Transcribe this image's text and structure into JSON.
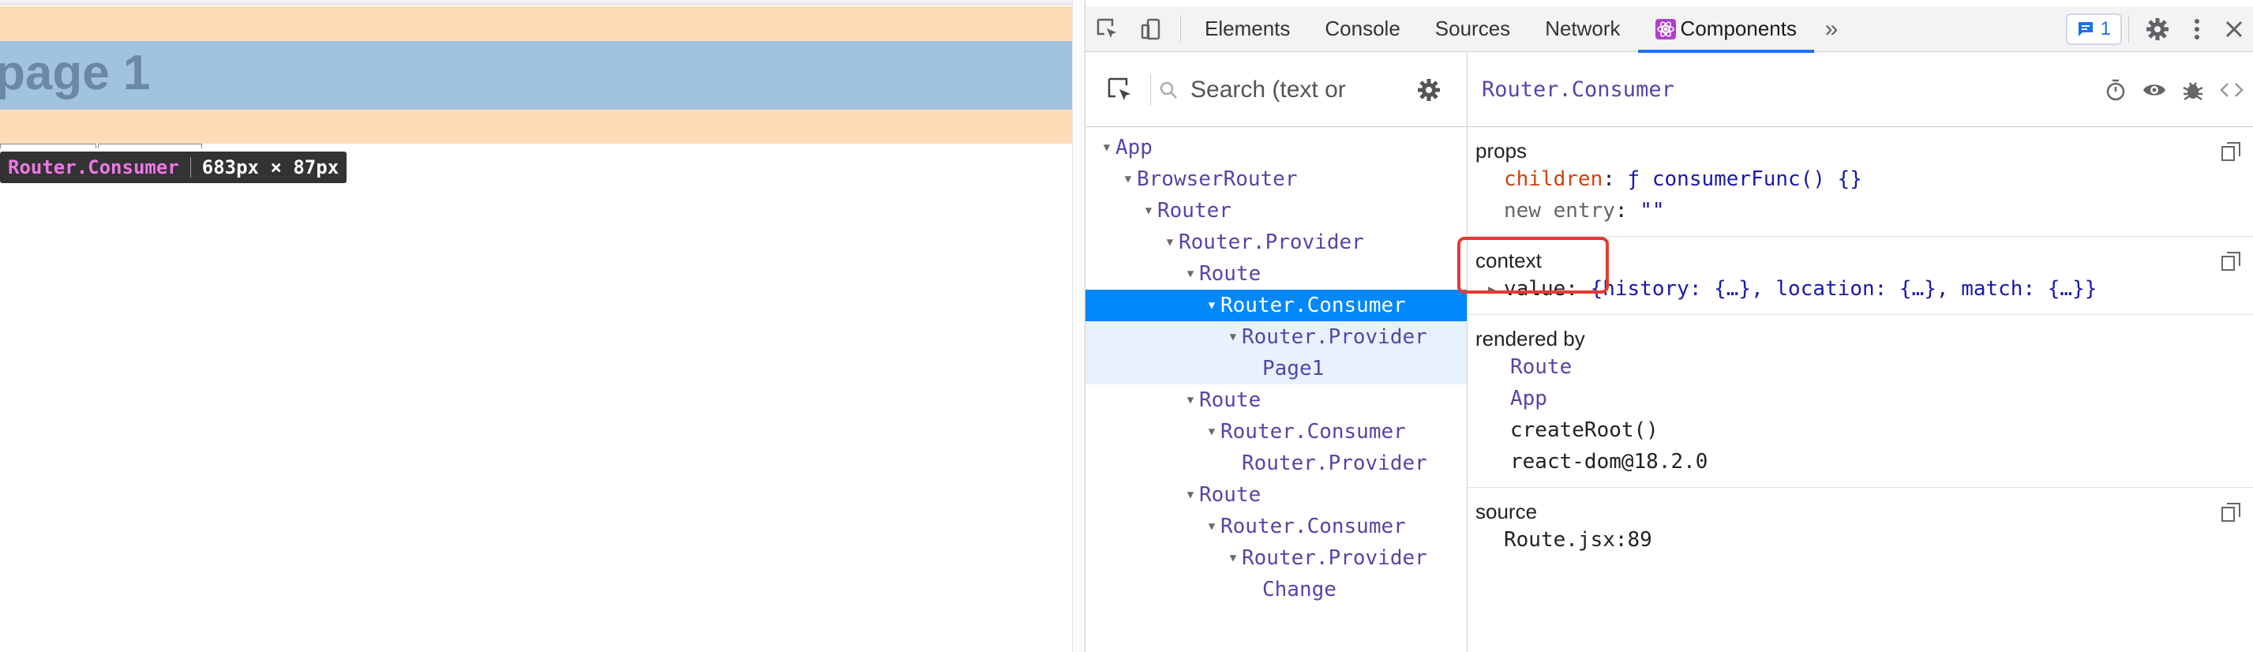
{
  "page": {
    "heading": "page 1",
    "tooltip": {
      "component": "Router.Consumer",
      "size": "683px × 87px"
    }
  },
  "devtools": {
    "tabs": [
      "Elements",
      "Console",
      "Sources",
      "Network",
      "Components"
    ],
    "active_tab": "Components",
    "issues_count": "1",
    "search_placeholder": "Search (text or",
    "tree": [
      {
        "label": "App",
        "expanded": true
      },
      {
        "label": "BrowserRouter",
        "expanded": true
      },
      {
        "label": "Router",
        "expanded": true
      },
      {
        "label": "Router.Provider",
        "expanded": true
      },
      {
        "label": "Route",
        "expanded": true
      },
      {
        "label": "Router.Consumer",
        "expanded": true,
        "selected": true
      },
      {
        "label": "Router.Provider",
        "expanded": true
      },
      {
        "label": "Page1",
        "expanded": false
      },
      {
        "label": "Route",
        "expanded": true
      },
      {
        "label": "Router.Consumer",
        "expanded": true
      },
      {
        "label": "Router.Provider",
        "expanded": false
      },
      {
        "label": "Route",
        "expanded": true
      },
      {
        "label": "Router.Consumer",
        "expanded": true
      },
      {
        "label": "Router.Provider",
        "expanded": true
      },
      {
        "label": "Change",
        "expanded": false
      }
    ],
    "inspector": {
      "component_name": "Router.Consumer",
      "props": {
        "title": "props",
        "children_key": "children",
        "children_value": "ƒ consumerFunc() {}",
        "new_entry_key": "new entry",
        "new_entry_value": "\"\""
      },
      "context": {
        "title": "context",
        "value_key": "value",
        "value_value": "{history: {…}, location: {…}, match: {…}}"
      },
      "rendered_by": {
        "title": "rendered by",
        "items": [
          "Route",
          "App",
          "createRoot()",
          "react-dom@18.2.0"
        ]
      },
      "source": {
        "title": "source",
        "location": "Route.jsx:89"
      }
    },
    "highlight_color": "#e53a32",
    "accent_color": "#1a73e8",
    "selection_color": "#0088fa"
  }
}
